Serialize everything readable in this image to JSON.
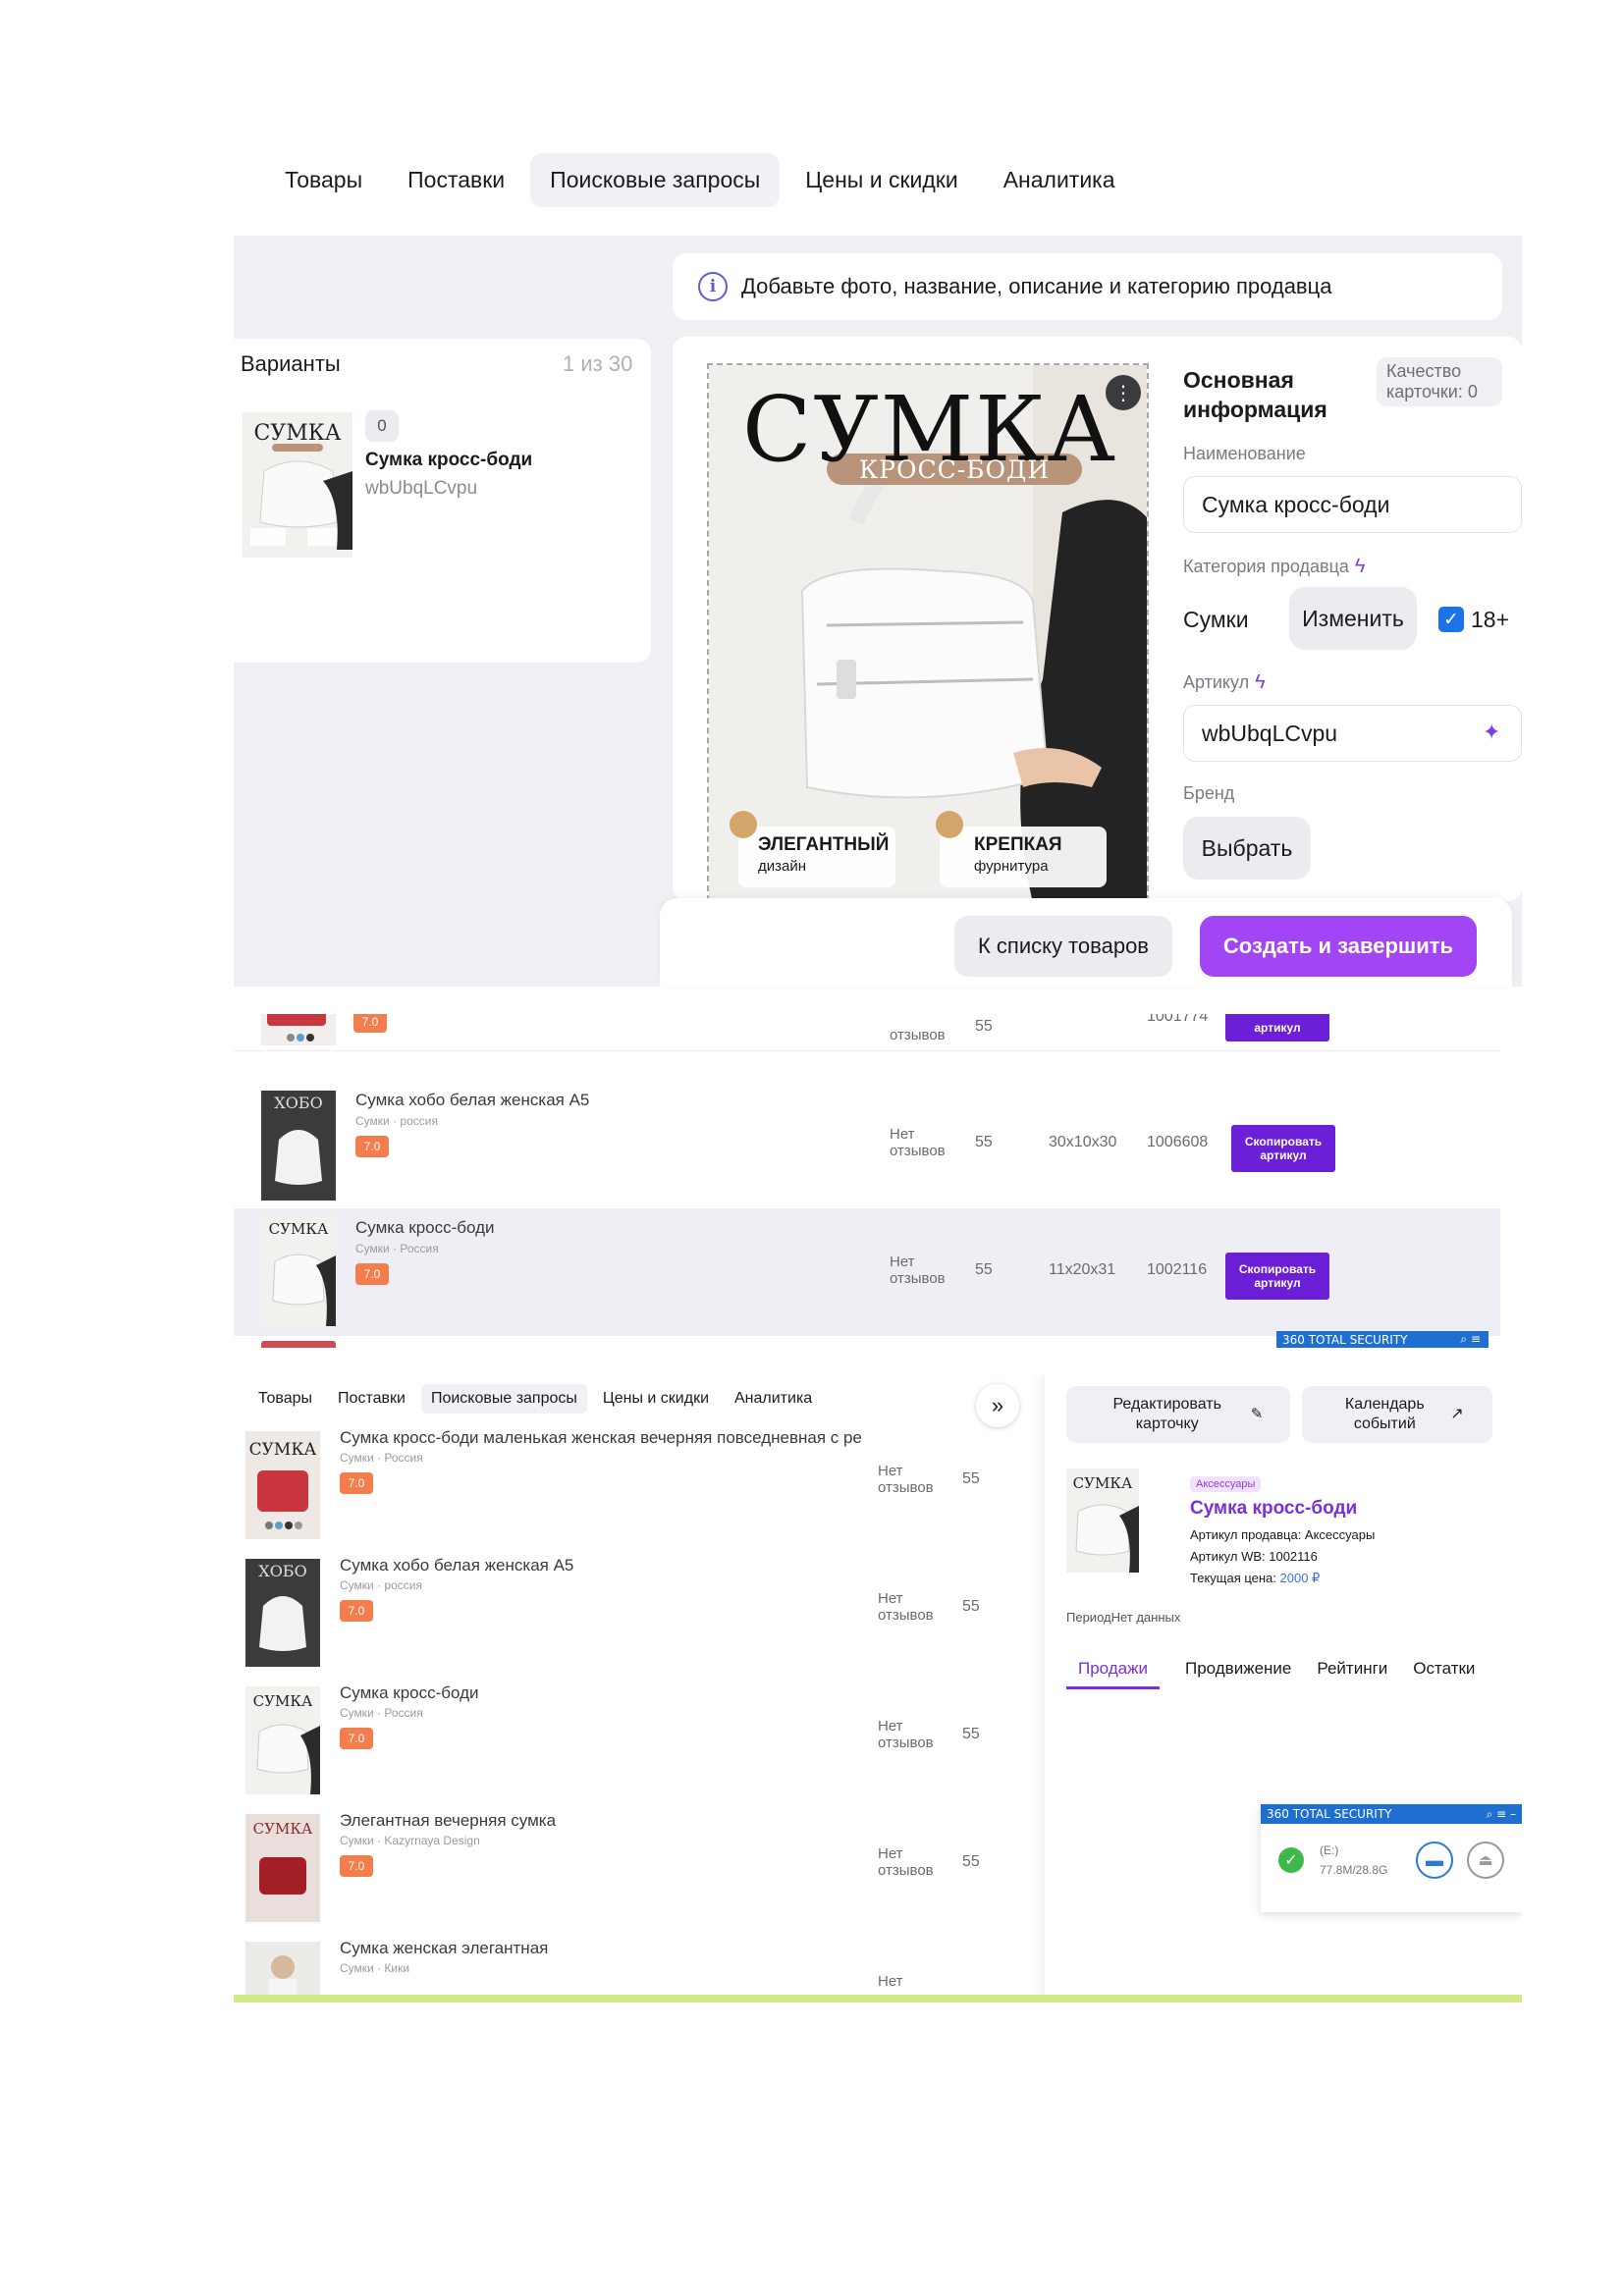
{
  "top_tabs": [
    "Товары",
    "Поставки",
    "Поисковые запросы",
    "Цены и скидки",
    "Аналитика"
  ],
  "notice": "Добавьте фото, название, описание и категорию продавца",
  "variants": {
    "title": "Варианты",
    "count": "1 из 30",
    "item": {
      "badge": "0",
      "name": "Сумка кросс-боди",
      "sku": "wbUbqLCvpu"
    }
  },
  "photo": {
    "headline": "СУМКА",
    "subtitle": "КРОСС-БОДИ",
    "feature1_title": "ЭЛЕГАНТНЫЙ",
    "feature1_sub": "дизайн",
    "feature2_title": "КРЕПКАЯ",
    "feature2_sub": "фурнитура"
  },
  "form": {
    "section_title": "Основная информация",
    "quality": "Качество карточки: 0",
    "name_label": "Наименование",
    "name_value": "Сумка кросс-боди",
    "category_label": "Категория продавца",
    "category_value": "Сумки",
    "change_btn": "Изменить",
    "adult_label": "18+",
    "sku_label": "Артикул",
    "sku_value": "wbUbqLCvpu",
    "brand_label": "Бренд",
    "brand_btn": "Выбрать"
  },
  "actions": {
    "back": "К списку товаров",
    "create": "Создать и завершить"
  },
  "table_top": {
    "rows": [
      {
        "name": "",
        "category": "",
        "rating": "7.0",
        "reviews": "отзывов",
        "count": "55",
        "size": "",
        "id": "1001774",
        "button": "артикул",
        "highlight": false
      },
      {
        "name": "Сумка хобо белая женская А5",
        "category": "Сумки · россия",
        "rating": "7.0",
        "reviews": "Нет отзывов",
        "count": "55",
        "size": "30х10х30",
        "id": "1006608",
        "button": "Скопировать артикул",
        "highlight": false
      },
      {
        "name": "Сумка кросс-боди",
        "category": "Сумки · Россия",
        "rating": "7.0",
        "reviews": "Нет отзывов",
        "count": "55",
        "size": "11х20х31",
        "id": "1002116",
        "button": "Скопировать артикул",
        "highlight": true
      }
    ],
    "security_label": "360 TOTAL SECURITY"
  },
  "bottom_view": {
    "tabs": [
      "Товары",
      "Поставки",
      "Поисковые запросы",
      "Цены и скидки",
      "Аналитика"
    ],
    "products": [
      {
        "name": "Сумка кросс-боди маленькая женская вечерняя повседневная с ре",
        "category": "Сумки · Россия",
        "rating": "7.0",
        "reviews": "Нет отзывов",
        "count": "55"
      },
      {
        "name": "Сумка хобо белая женская А5",
        "category": "Сумки · россия",
        "rating": "7.0",
        "reviews": "Нет отзывов",
        "count": "55"
      },
      {
        "name": "Сумка кросс-боди",
        "category": "Сумки · Россия",
        "rating": "7.0",
        "reviews": "Нет отзывов",
        "count": "55"
      },
      {
        "name": "Элегантная вечерняя сумка",
        "category": "Сумки · Kazyrnaya Design",
        "rating": "7.0",
        "reviews": "Нет отзывов",
        "count": "55"
      },
      {
        "name": "Сумка женская элегантная",
        "category": "Сумки · Кики",
        "rating": "",
        "reviews": "Нет",
        "count": ""
      }
    ],
    "side": {
      "edit_btn": "Редактировать карточку",
      "calendar_btn": "Календарь событий",
      "tag": "Аксессуары",
      "title": "Сумка кросс-боди",
      "seller_sku": "Артикул продавца: Аксессуары",
      "wb_sku": "Артикул WB: 1002116",
      "price_label": "Текущая цена: ",
      "price": "2000 ₽",
      "period": "ПериодНет данных",
      "tabs": [
        "Продажи",
        "Продвижение",
        "Рейтинги",
        "Остатки"
      ],
      "security_label": "360 TOTAL SECURITY",
      "drive": "(E:)",
      "drive_size": "77.8M/28.8G"
    }
  },
  "colors": {
    "accent": "#a245f5",
    "purple_button": "#6b1fd6",
    "rating": "#f47d4e",
    "info": "#5b5fd6"
  }
}
